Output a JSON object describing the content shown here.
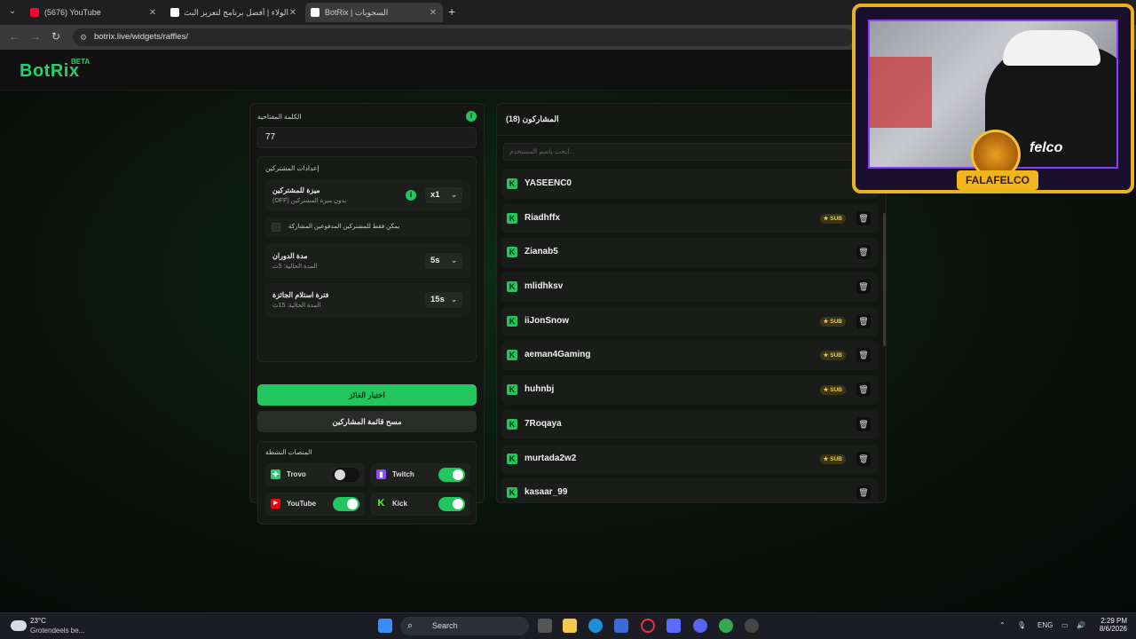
{
  "browser": {
    "tabs": [
      {
        "title": "(5676) YouTube",
        "active": false,
        "favicon_color": "#ff0033"
      },
      {
        "title": "الولاء | أفضل برنامج لتعزيز البث",
        "active": false,
        "favicon_color": "#ffffff"
      },
      {
        "title": "BotRix | السحوبات",
        "active": true,
        "favicon_color": "#ffffff"
      }
    ],
    "url": "botrix.live/widgets/raffles/"
  },
  "header": {
    "logo": "BotRix",
    "badge": "BETA"
  },
  "settings": {
    "keyword_label": "الكلمة المفتاحية",
    "keyword_value": "77",
    "participants_settings_label": "إعدادات المشتركين",
    "sub_feature": {
      "title": "ميزة للمشتركين",
      "subtitle": "بدون ميزة المشتركين (OFF)",
      "value": "x1"
    },
    "only_subs_label": "يمكن فقط للمشتركين المدفوعين المشاركة",
    "spin_duration": {
      "title": "مدة الدوران",
      "subtitle": "المدة الحالية: 5ث",
      "value": "5s"
    },
    "claim_period": {
      "title": "فترة استلام الجائزة",
      "subtitle": "المدة الحالية: 15ث",
      "value": "15s"
    },
    "pick_winner_label": "اختيار الفائز",
    "clear_list_label": "مسح قائمة المشاركين",
    "platforms_label": "المنصات النشطة",
    "platforms": [
      {
        "name": "Trovo",
        "enabled": false,
        "color": "#19d66b"
      },
      {
        "name": "Twitch",
        "enabled": true,
        "color": "#9146ff"
      },
      {
        "name": "YouTube",
        "enabled": true,
        "color": "#ff0000"
      },
      {
        "name": "Kick",
        "enabled": true,
        "color": "#53fc18"
      }
    ]
  },
  "participants": {
    "title": "المشاركون (18)",
    "search_placeholder": "...ابحث باسم المستخدم",
    "sub_label": "SUB",
    "items": [
      {
        "name": "YASEENC0",
        "sub": false
      },
      {
        "name": "Riadhffx",
        "sub": true
      },
      {
        "name": "Zianab5",
        "sub": false
      },
      {
        "name": "mlidhksv",
        "sub": false
      },
      {
        "name": "iiJonSnow",
        "sub": true
      },
      {
        "name": "aeman4Gaming",
        "sub": true
      },
      {
        "name": "huhnbj",
        "sub": true
      },
      {
        "name": "7Roqaya",
        "sub": false
      },
      {
        "name": "murtada2w2",
        "sub": true
      },
      {
        "name": "kasaar_99",
        "sub": false
      }
    ]
  },
  "overlay": {
    "brand": "FALAFELCO",
    "shirt_text": "felco"
  },
  "taskbar": {
    "temperature": "23°C",
    "weather": "Grotendeels be...",
    "search_label": "Search",
    "language": "ENG",
    "time": "2:29 PM",
    "date": "8/6/2026"
  },
  "colors": {
    "accent": "#22c55e",
    "sub_badge": "#e8c84a",
    "overlay_border": "#e8b320"
  }
}
